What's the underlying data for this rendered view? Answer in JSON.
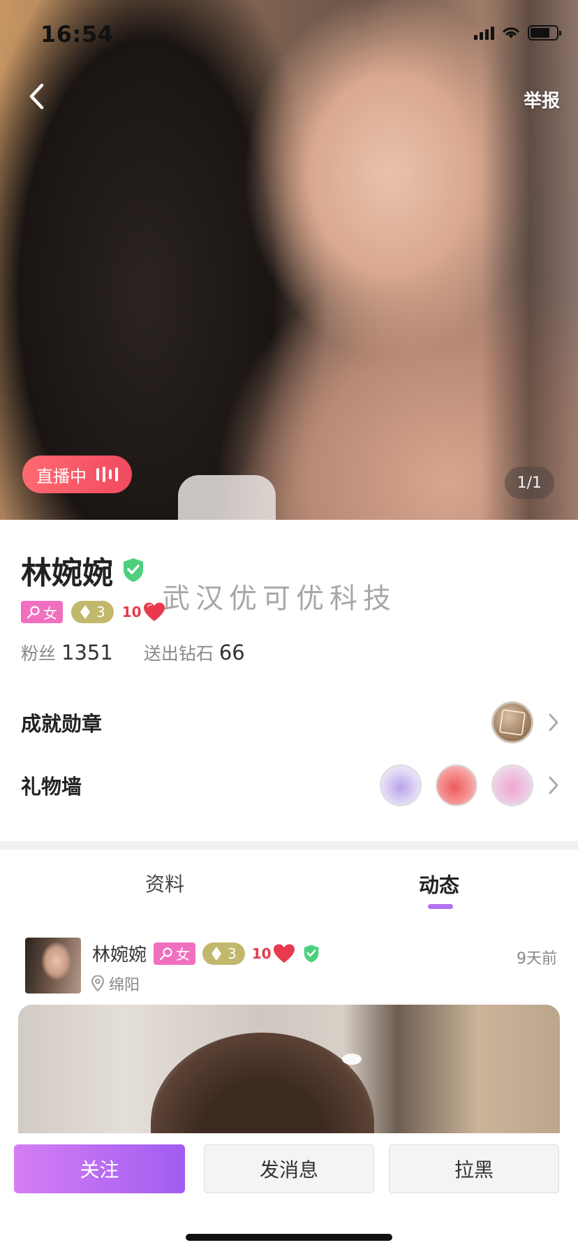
{
  "status_bar": {
    "time": "16:54"
  },
  "hero": {
    "report_label": "举报",
    "live_label": "直播中",
    "photo_counter": "1/1"
  },
  "profile": {
    "name": "林婉婉",
    "verified": true,
    "gender_label": "女",
    "level": "3",
    "heart_level": "10",
    "fans_label": "粉丝",
    "fans_count": "1351",
    "diamonds_label": "送出钻石",
    "diamonds_count": "66",
    "achievements_label": "成就勋章",
    "gift_wall_label": "礼物墙"
  },
  "watermark": "武汉优可优科技",
  "tabs": {
    "info_label": "资料",
    "feed_label": "动态",
    "active": "动态"
  },
  "post": {
    "author_name": "林婉婉",
    "gender_label": "女",
    "level": "3",
    "heart_level": "10",
    "location": "绵阳",
    "time_ago": "9天前"
  },
  "actions": {
    "follow_label": "关注",
    "message_label": "发消息",
    "block_label": "拉黑"
  },
  "colors": {
    "accent_purple": "#a15df0",
    "live_red": "#f04a61",
    "gender_pink": "#f06fbf",
    "level_olive": "#c1b86b",
    "verify_green": "#4cd07d"
  },
  "icons": [
    "back-arrow-icon",
    "signal-icon",
    "wifi-icon",
    "battery-icon",
    "live-bars-icon",
    "verified-shield-icon",
    "gender-female-icon",
    "diamond-icon",
    "heart-icon",
    "chevron-right-icon",
    "location-pin-icon"
  ]
}
